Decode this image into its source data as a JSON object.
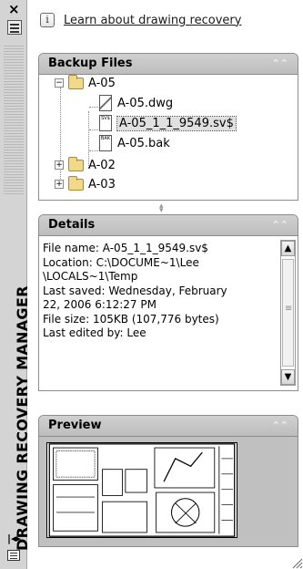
{
  "strip": {
    "title": "DRAWING RECOVERY MANAGER",
    "close_glyph": "×",
    "autohide_glyph": "|◂▸"
  },
  "learn": {
    "link_text": "Learn about drawing recovery",
    "icon_glyph": "i"
  },
  "backup": {
    "header": "Backup Files",
    "tree": [
      {
        "label": "A-05",
        "type": "folder",
        "expanded": true
      },
      {
        "label": "A-05.dwg",
        "type": "dwg"
      },
      {
        "label": "A-05_1_1_9549.sv$",
        "type": "sv$",
        "icon_text": "SV$",
        "selected": true
      },
      {
        "label": "A-05.bak",
        "type": "bak",
        "icon_text": "BAK"
      },
      {
        "label": "A-02",
        "type": "folder",
        "expanded": false
      },
      {
        "label": "A-03",
        "type": "folder",
        "expanded": false
      }
    ]
  },
  "details": {
    "header": "Details",
    "lines": [
      "File name: A-05_1_1_9549.sv$",
      "Location: C:\\DOCUME~1\\Lee",
      "\\LOCALS~1\\Temp",
      "Last saved: Wednesday, February",
      "22, 2006  6:12:27 PM",
      "File size: 105KB (107,776 bytes)",
      "Last edited by: Lee"
    ]
  },
  "preview": {
    "header": "Preview"
  },
  "colors": {
    "panel_header": "#c6c6c6",
    "strip": "#d4d4d4",
    "preview_bg": "#c0c0c0"
  }
}
